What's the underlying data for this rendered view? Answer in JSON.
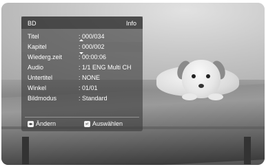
{
  "panel": {
    "title": "BD",
    "info": "Info",
    "rows": [
      {
        "label": "Titel",
        "value": ": 000/034"
      },
      {
        "label": "Kapitel",
        "value": ": 000/002"
      },
      {
        "label": "Wiederg.zeit",
        "value": ": 00:00:06"
      },
      {
        "label": "Audio",
        "value": ": 1/1 ENG Multi CH"
      },
      {
        "label": "Untertitel",
        "value": ": NONE"
      },
      {
        "label": "Winkel",
        "value": ": 01/01"
      },
      {
        "label": "Bildmodus",
        "value": ": Standard"
      }
    ],
    "footer": {
      "change_label": "Ändern",
      "select_label": "Auswählen"
    }
  },
  "icons": {
    "change": "left-right-arrows-icon",
    "select": "enter-icon"
  }
}
